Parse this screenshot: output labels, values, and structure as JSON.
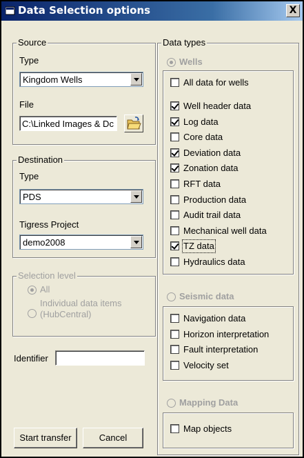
{
  "window": {
    "title": "Data Selection options",
    "close_label": "X"
  },
  "source": {
    "legend": "Source",
    "type_label": "Type",
    "type_value": "Kingdom Wells",
    "file_label": "File",
    "file_value": "C:\\Linked Images & Dc"
  },
  "destination": {
    "legend": "Destination",
    "type_label": "Type",
    "type_value": "PDS",
    "project_label": "Tigress Project",
    "project_value": "demo2008"
  },
  "selection_level": {
    "legend": "Selection level",
    "opt_all": "All",
    "opt_individual_line1": "Individual data items",
    "opt_individual_line2": "(HubCentral)",
    "selected": "All"
  },
  "identifier": {
    "label": "Identifier",
    "value": ""
  },
  "buttons": {
    "start": "Start transfer",
    "cancel": "Cancel"
  },
  "data_types": {
    "legend": "Data types",
    "wells": {
      "label": "Wells",
      "all_data": {
        "label": "All data for wells",
        "checked": false
      },
      "items": [
        {
          "label": "Well header data",
          "checked": true
        },
        {
          "label": "Log data",
          "checked": true
        },
        {
          "label": "Core data",
          "checked": false
        },
        {
          "label": "Deviation data",
          "checked": true
        },
        {
          "label": "Zonation data",
          "checked": true
        },
        {
          "label": "RFT data",
          "checked": false
        },
        {
          "label": "Production data",
          "checked": false
        },
        {
          "label": "Audit trail data",
          "checked": false
        },
        {
          "label": "Mechanical well data",
          "checked": false
        },
        {
          "label": "TZ data",
          "checked": true
        },
        {
          "label": "Hydraulics data",
          "checked": false
        }
      ]
    },
    "seismic": {
      "label": "Seismic data",
      "items": [
        {
          "label": "Navigation data",
          "checked": false
        },
        {
          "label": "Horizon interpretation",
          "checked": false
        },
        {
          "label": "Fault interpretation",
          "checked": false
        },
        {
          "label": "Velocity set",
          "checked": false
        }
      ]
    },
    "mapping": {
      "label": "Mapping Data",
      "items": [
        {
          "label": "Map objects",
          "checked": false
        }
      ]
    }
  }
}
